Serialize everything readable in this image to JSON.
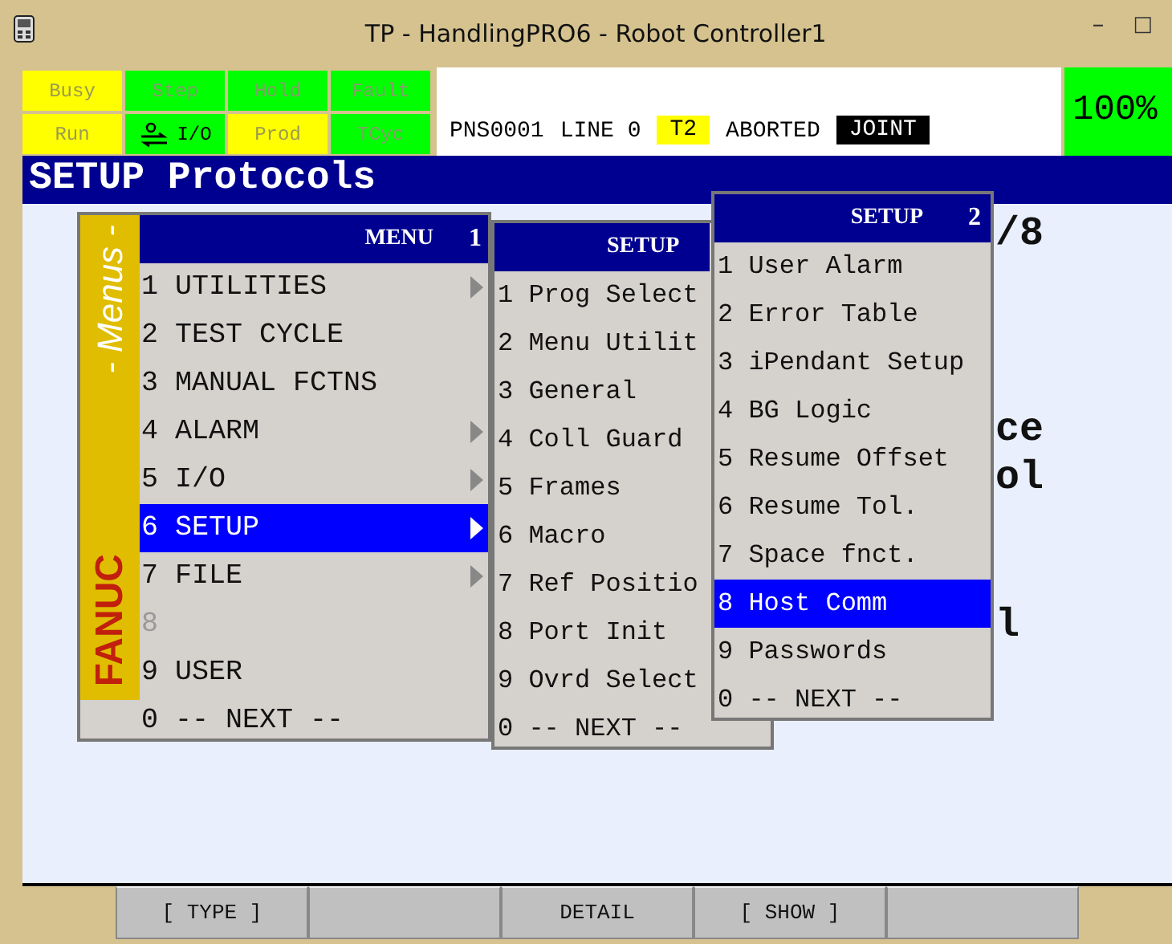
{
  "window": {
    "title": "TP - HandlingPRO6 - Robot Controller1",
    "controls": [
      "–",
      "□"
    ]
  },
  "status_lamps": [
    {
      "label": "Busy",
      "on": true,
      "kind": "text"
    },
    {
      "label": "Step",
      "on": false,
      "kind": "text"
    },
    {
      "label": "Hold",
      "on": false,
      "kind": "text"
    },
    {
      "label": "Fault",
      "on": false,
      "kind": "text"
    },
    {
      "label": "Run",
      "on": true,
      "kind": "text"
    },
    {
      "label": "I/O",
      "on": false,
      "kind": "icon"
    },
    {
      "label": "Prod",
      "on": true,
      "kind": "text"
    },
    {
      "label": "TCyc",
      "on": false,
      "kind": "text"
    }
  ],
  "status_line": {
    "program": "PNS0001",
    "line": "LINE 0",
    "tool": "T2",
    "state": "ABORTED",
    "coord": "JOINT"
  },
  "override": "100%",
  "screen_title": "SETUP Protocols",
  "background_text": [
    "/8",
    "ce",
    "ol",
    "l"
  ],
  "menus": [
    {
      "title": "MENU",
      "page": "1",
      "side_label": "- Menus -",
      "brand": "FANUC",
      "items": [
        {
          "text": "1 UTILITIES",
          "submenu": true,
          "disabled": false,
          "selected": false
        },
        {
          "text": "2 TEST CYCLE",
          "submenu": false,
          "disabled": false,
          "selected": false
        },
        {
          "text": "3 MANUAL FCTNS",
          "submenu": false,
          "disabled": false,
          "selected": false
        },
        {
          "text": "4 ALARM",
          "submenu": true,
          "disabled": false,
          "selected": false
        },
        {
          "text": "5 I/O",
          "submenu": true,
          "disabled": false,
          "selected": false
        },
        {
          "text": "6 SETUP",
          "submenu": true,
          "disabled": false,
          "selected": true
        },
        {
          "text": "7 FILE",
          "submenu": true,
          "disabled": false,
          "selected": false
        },
        {
          "text": "8",
          "submenu": false,
          "disabled": true,
          "selected": false
        },
        {
          "text": "9 USER",
          "submenu": false,
          "disabled": false,
          "selected": false
        },
        {
          "text": "0 -- NEXT --",
          "submenu": false,
          "disabled": false,
          "selected": false
        }
      ]
    },
    {
      "title": "SETUP",
      "items": [
        {
          "text": "1 Prog Select",
          "selected": false
        },
        {
          "text": "2 Menu Utilit",
          "selected": false
        },
        {
          "text": "3 General",
          "selected": false
        },
        {
          "text": "4 Coll Guard",
          "selected": false
        },
        {
          "text": "5 Frames",
          "selected": false
        },
        {
          "text": "6 Macro",
          "selected": false
        },
        {
          "text": "7 Ref Positio",
          "selected": false
        },
        {
          "text": "8 Port Init",
          "selected": false
        },
        {
          "text": "9 Ovrd Select",
          "selected": false
        },
        {
          "text": "0 -- NEXT --",
          "selected": false
        }
      ]
    },
    {
      "title": "SETUP",
      "page": "2",
      "items": [
        {
          "text": "1 User Alarm",
          "selected": false
        },
        {
          "text": "2 Error Table",
          "selected": false
        },
        {
          "text": "3 iPendant Setup",
          "selected": false
        },
        {
          "text": "4 BG Logic",
          "selected": false
        },
        {
          "text": "5 Resume Offset",
          "selected": false
        },
        {
          "text": "6 Resume Tol.",
          "selected": false
        },
        {
          "text": "7 Space fnct.",
          "selected": false
        },
        {
          "text": "8 Host Comm",
          "selected": true
        },
        {
          "text": "9 Passwords",
          "selected": false
        },
        {
          "text": "0 -- NEXT --",
          "selected": false
        }
      ]
    }
  ],
  "function_keys": [
    {
      "kind": "labeled",
      "label": "[ TYPE ]"
    },
    {
      "kind": "blank"
    },
    {
      "kind": "labeled",
      "label": "DETAIL"
    },
    {
      "kind": "labeled",
      "label": "[ SHOW ]"
    },
    {
      "kind": "blank"
    }
  ]
}
